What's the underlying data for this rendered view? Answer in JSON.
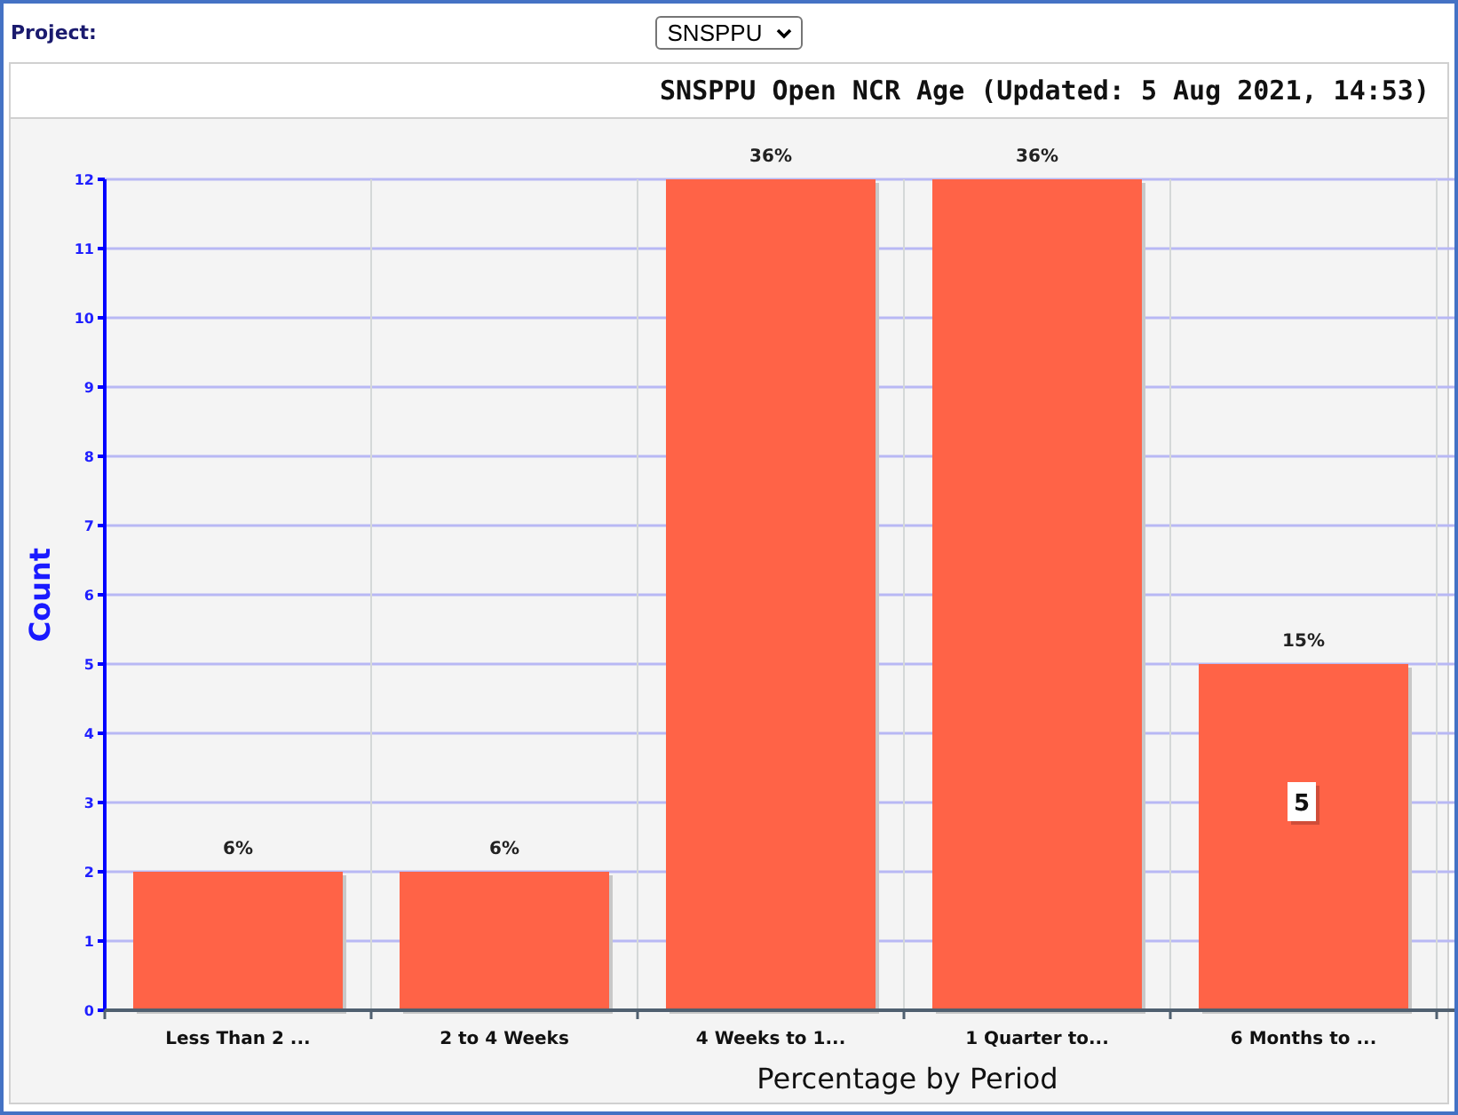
{
  "header": {
    "label": "Project:",
    "project_select": {
      "value": "SNSPPU"
    }
  },
  "chart": {
    "chart_data": {
      "type": "bar",
      "title": "SNSPPU Open NCR Age (Updated: 5 Aug 2021, 14:53)",
      "xlabel": "Percentage by Period",
      "ylabel": "Count",
      "categories": [
        "Less Than 2 ...",
        "2 to 4 Weeks",
        "4 Weeks to 1...",
        "1 Quarter to...",
        "6 Months to ..."
      ],
      "series": [
        {
          "color": "#ff6347",
          "values": [
            2,
            2,
            12,
            12,
            5
          ]
        }
      ],
      "grid": true,
      "ylim": [
        0,
        12
      ],
      "yticks": [
        0,
        1,
        2,
        3,
        4,
        5,
        6,
        7,
        8,
        9,
        10,
        11,
        12
      ],
      "value_labels": [
        "6%",
        "6%",
        "36%",
        "36%",
        "15%"
      ],
      "annotations": [
        {
          "x": "6 Months to ...",
          "text": "5"
        }
      ]
    }
  }
}
